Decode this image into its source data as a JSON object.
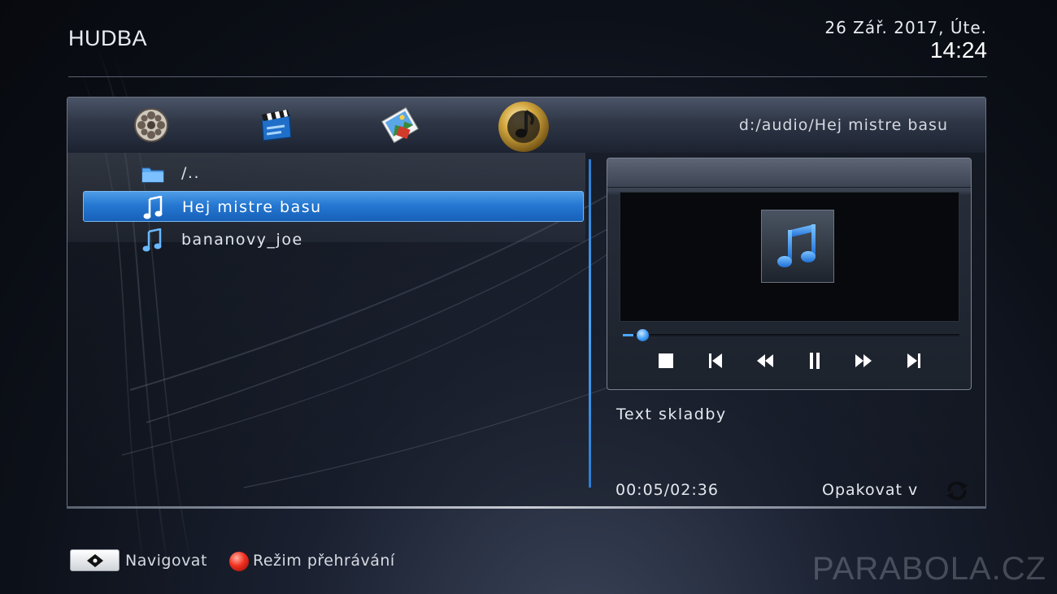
{
  "header": {
    "title": "HUDBA",
    "date": "26 Zář. 2017, Úte.",
    "time": "14:24"
  },
  "media_tabs": [
    {
      "name": "video",
      "icon": "film-reel-icon",
      "active": false
    },
    {
      "name": "movies",
      "icon": "clapperboard-icon",
      "active": false
    },
    {
      "name": "photos",
      "icon": "photo-icon",
      "active": false
    },
    {
      "name": "music",
      "icon": "music-disc-icon",
      "active": true
    }
  ],
  "current_path": "d:/audio/Hej mistre basu",
  "file_list": [
    {
      "label": "/..",
      "icon": "folder-icon",
      "selected": false
    },
    {
      "label": "Hej mistre basu",
      "icon": "music-note-icon",
      "selected": true
    },
    {
      "label": "bananovy_joe",
      "icon": "music-note-icon",
      "selected": false
    }
  ],
  "player": {
    "album_art_icon": "music-note-icon",
    "progress": 0.0325,
    "controls": [
      "stop-icon",
      "previous-track-icon",
      "rewind-icon",
      "pause-icon",
      "fast-forward-icon",
      "next-track-icon"
    ],
    "lyrics_label": "Text skladby",
    "time": "00:05/02:36",
    "repeat_label": "Opakovat v",
    "repeat_icon": "repeat-icon"
  },
  "footer": {
    "navigate_label": "Navigovat",
    "mode_label": "Režim přehrávání",
    "watermark": "PARABOLA.CZ"
  },
  "colors": {
    "accent": "#2578d2",
    "progress": "#4aa8ff",
    "red_key": "#f03020"
  }
}
